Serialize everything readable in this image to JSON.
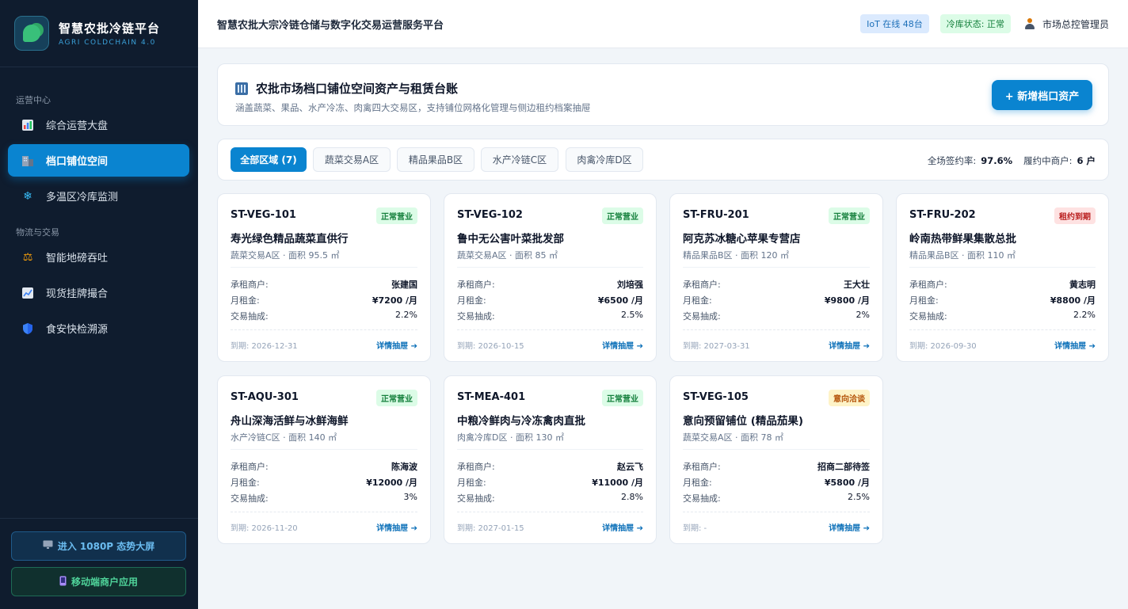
{
  "sidebar": {
    "brand_title": "智慧农批冷链平台",
    "brand_sub": "AGRI COLDCHAIN 4.0",
    "sections": [
      {
        "title": "运营中心"
      },
      {
        "title": "物流与交易"
      }
    ],
    "items": [
      {
        "label": "综合运营大盘",
        "icon": "chart-icon"
      },
      {
        "label": "档口铺位空间",
        "icon": "building-icon"
      },
      {
        "label": "多温区冷库监测",
        "icon": "snowflake-icon"
      },
      {
        "label": "智能地磅吞吐",
        "icon": "scale-icon"
      },
      {
        "label": "现货挂牌撮合",
        "icon": "trend-icon"
      },
      {
        "label": "食安快检溯源",
        "icon": "shield-icon"
      }
    ],
    "bottom_buttons": [
      {
        "label": "进入 1080P 态势大屏",
        "icon": "monitor-icon"
      },
      {
        "label": "移动端商户应用",
        "icon": "phone-icon"
      }
    ]
  },
  "topbar": {
    "title": "智慧农批大宗冷链仓储与数字化交易运营服务平台",
    "iot_badge": "IoT 在线 48台",
    "cold_badge": "冷库状态: 正常",
    "user_name": "市场总控管理员"
  },
  "header": {
    "title": "农批市场档口铺位空间资产与租赁台账",
    "subtitle": "涵盖蔬菜、果品、水产冷冻、肉禽四大交易区，支持铺位网格化管理与侧边租约档案抽屉",
    "add_button": "+ 新增档口资产"
  },
  "filters": {
    "tabs": [
      "全部区域 (7)",
      "蔬菜交易A区",
      "精品果品B区",
      "水产冷链C区",
      "肉禽冷库D区"
    ],
    "sign_rate_label": "全场签约率:",
    "sign_rate_value": "97.6%",
    "tenants_label": "履约中商户:",
    "tenants_value": "6 户"
  },
  "labels": {
    "tenant": "承租商户:",
    "rent": "月租金:",
    "commission": "交易抽成:",
    "detail": "详情抽屉 ➔"
  },
  "stalls": [
    {
      "code": "ST-VEG-101",
      "status": "正常营业",
      "name": "寿光绿色精品蔬菜直供行",
      "zone": "蔬菜交易A区 · 面积 95.5 ㎡",
      "tenant": "张建国",
      "rent": "¥7200 /月",
      "commission": "2.2%",
      "due": "到期: 2026-12-31"
    },
    {
      "code": "ST-VEG-102",
      "status": "正常营业",
      "name": "鲁中无公害叶菜批发部",
      "zone": "蔬菜交易A区 · 面积 85 ㎡",
      "tenant": "刘培强",
      "rent": "¥6500 /月",
      "commission": "2.5%",
      "due": "到期: 2026-10-15"
    },
    {
      "code": "ST-FRU-201",
      "status": "正常营业",
      "name": "阿克苏冰糖心苹果专营店",
      "zone": "精品果品B区 · 面积 120 ㎡",
      "tenant": "王大壮",
      "rent": "¥9800 /月",
      "commission": "2%",
      "due": "到期: 2027-03-31"
    },
    {
      "code": "ST-FRU-202",
      "status": "租约到期",
      "name": "岭南热带鲜果集散总批",
      "zone": "精品果品B区 · 面积 110 ㎡",
      "tenant": "黄志明",
      "rent": "¥8800 /月",
      "commission": "2.2%",
      "due": "到期: 2026-09-30"
    },
    {
      "code": "ST-AQU-301",
      "status": "正常营业",
      "name": "舟山深海活鲜与冰鲜海鲜",
      "zone": "水产冷链C区 · 面积 140 ㎡",
      "tenant": "陈海波",
      "rent": "¥12000 /月",
      "commission": "3%",
      "due": "到期: 2026-11-20"
    },
    {
      "code": "ST-MEA-401",
      "status": "正常营业",
      "name": "中粮冷鲜肉与冷冻禽肉直批",
      "zone": "肉禽冷库D区 · 面积 130 ㎡",
      "tenant": "赵云飞",
      "rent": "¥11000 /月",
      "commission": "2.8%",
      "due": "到期: 2027-01-15"
    },
    {
      "code": "ST-VEG-105",
      "status": "意向洽谈",
      "name": "意向预留铺位 (精品茄果)",
      "zone": "蔬菜交易A区 · 面积 78 ㎡",
      "tenant": "招商二部待签",
      "rent": "¥5800 /月",
      "commission": "2.5%",
      "due": "到期: -"
    }
  ],
  "colors": {
    "accent": "#0a84d0",
    "sidebar_bg": "#0f1c2e",
    "status_ok": "#15803d",
    "status_expired": "#b91c1c",
    "status_negotiating": "#b45309"
  }
}
